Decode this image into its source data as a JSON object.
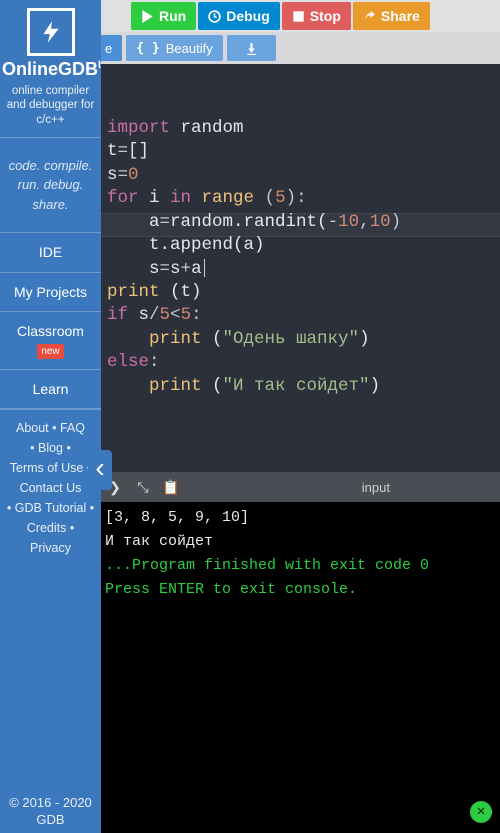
{
  "brand": {
    "name": "OnlineGDB",
    "tag": "beta"
  },
  "tagline": "online compiler and debugger for c/c++",
  "motto": "code. compile. run. debug. share.",
  "nav": {
    "ide": "IDE",
    "projects": "My Projects",
    "classroom": "Classroom",
    "classroom_badge": "new",
    "learn": "Learn"
  },
  "footer_links": [
    "About",
    "FAQ",
    "Blog",
    "Terms of Use",
    "Contact Us",
    "GDB Tutorial",
    "Credits",
    "Privacy"
  ],
  "copyright": "© 2016 - 2020 GDB",
  "toolbar": {
    "run": "Run",
    "debug": "Debug",
    "stop": "Stop",
    "share": "Share"
  },
  "tabs": {
    "file_suffix": "e",
    "beautify": "Beautify"
  },
  "code": {
    "l1_kw": "import",
    "l1_mod": " random",
    "l2_a": "t",
    "l2_b": "=",
    "l2_c": "[]",
    "l3_a": "s",
    "l3_b": "=",
    "l3_c": "0",
    "l4_a": "for",
    "l4_b": " i ",
    "l4_c": "in",
    "l4_d": " range ",
    "l4_e": "(",
    "l4_f": "5",
    "l4_g": "):",
    "l5_a": "    a",
    "l5_b": "=",
    "l5_c": "random.randint(",
    "l5_d": "-",
    "l5_e": "10",
    "l5_f": ",",
    "l5_g": "10",
    "l5_h": ")",
    "l6_a": "    t.append(a)",
    "l7_a": "    s",
    "l7_b": "=",
    "l7_c": "s",
    "l7_d": "+",
    "l7_e": "a",
    "l8_a": "print",
    "l8_b": " (t)",
    "l9_a": "if",
    "l9_b": " s",
    "l9_c": "/",
    "l9_d": "5",
    "l9_e": "<",
    "l9_f": "5",
    "l9_g": ":",
    "l10_a": "    print",
    "l10_b": " (",
    "l10_c": "\"Одень шапку\"",
    "l10_d": ")",
    "l11_a": "else",
    "l11_b": ":",
    "l12_a": "    print",
    "l12_b": " (",
    "l12_c": "\"И так сойдет\"",
    "l12_d": ")"
  },
  "panel": {
    "label": "input"
  },
  "console": {
    "line1": "[3, 8, 5, 9, 10]",
    "line2": "И так сойдет",
    "line3": "",
    "line4": "",
    "line5": "...Program finished with exit code 0",
    "line6": "Press ENTER to exit console."
  }
}
